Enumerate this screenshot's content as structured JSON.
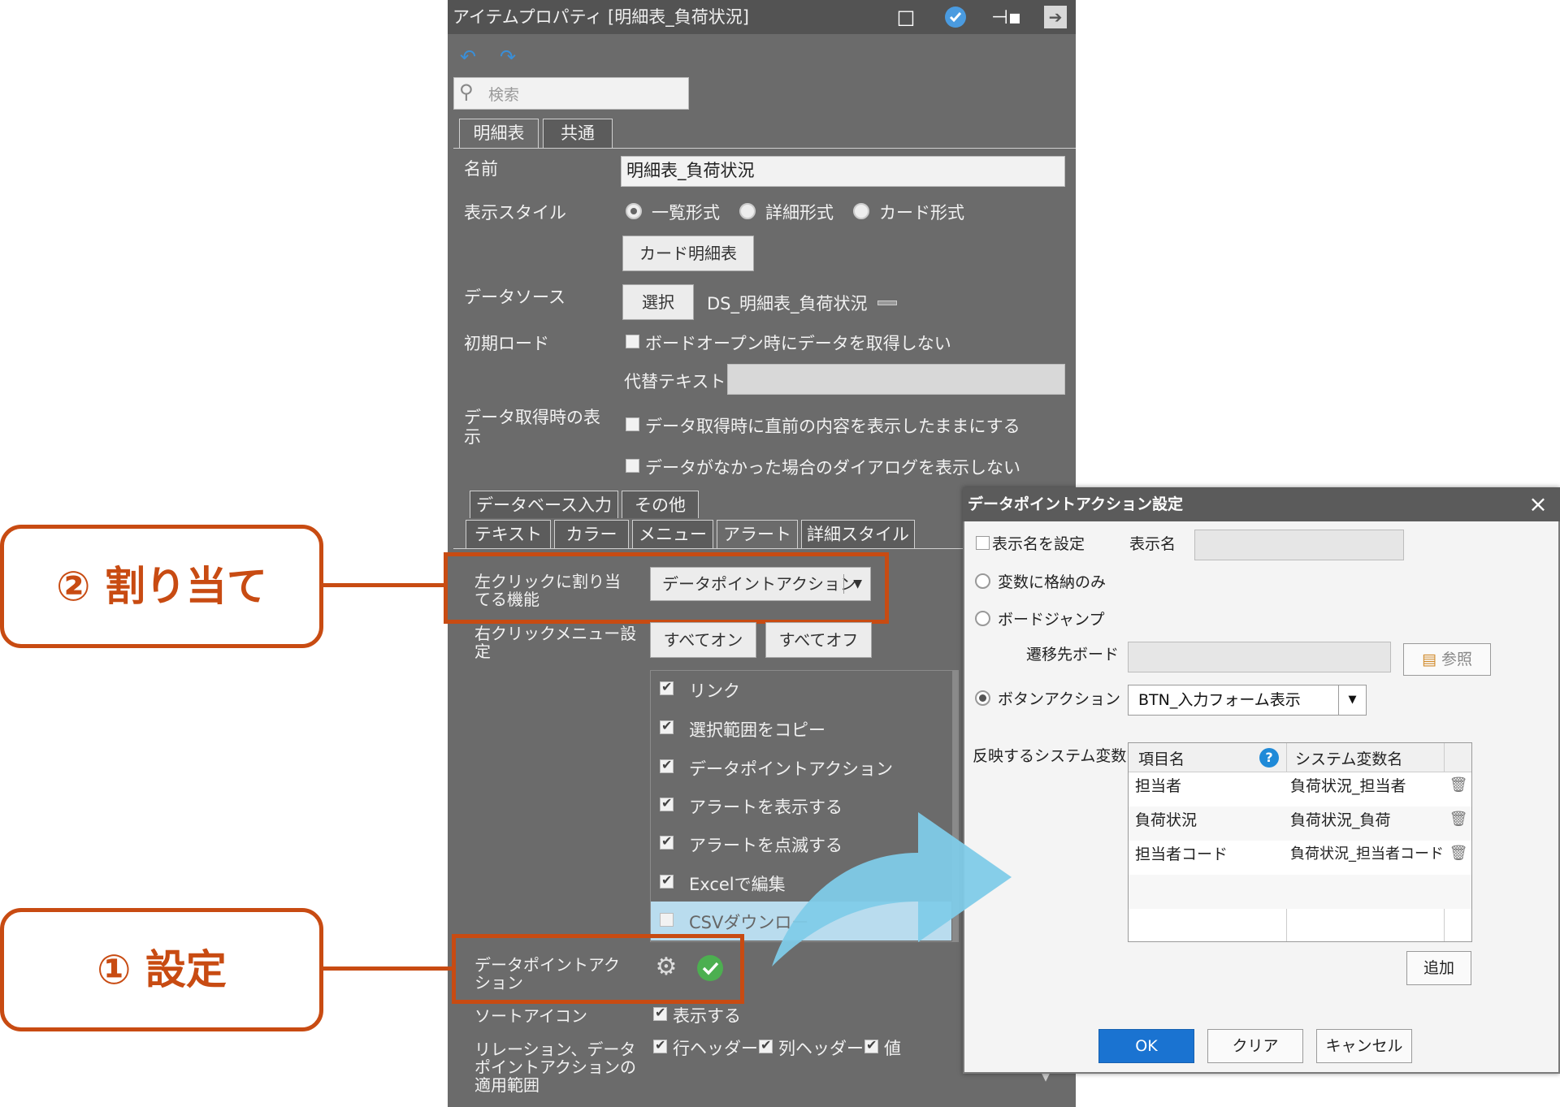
{
  "panel": {
    "title": "アイテムプロパティ [明細表_負荷状況]",
    "search_placeholder": "検索",
    "tabs": [
      "明細表",
      "共通"
    ],
    "name_label": "名前",
    "name_value": "明細表_負荷状況",
    "style_label": "表示スタイル",
    "style_options": [
      "一覧形式",
      "詳細形式",
      "カード形式"
    ],
    "card_button": "カード明細表",
    "datasource_label": "データソース",
    "select_button": "選択",
    "datasource_value": "DS_明細表_負荷状況",
    "initial_load_label": "初期ロード",
    "initial_load_checkbox": "ボードオープン時にデータを取得しない",
    "alt_text_label": "代替テキスト",
    "fetch_display_label_1": "データ取得時の表",
    "fetch_display_label_2": "示",
    "fetch_cb1": "データ取得時に直前の内容を表示したままにする",
    "fetch_cb2": "データがなかった場合のダイアログを表示しない",
    "subtabs_row1": [
      "データベース入力",
      "その他"
    ],
    "subtabs_row2": [
      "テキスト",
      "カラー",
      "メニュー",
      "アラート",
      "詳細スタイル"
    ],
    "left_click_label_1": "左クリックに割り当",
    "left_click_label_2": "てる機能",
    "left_click_value": "データポイントアクション",
    "right_menu_label_1": "右クリックメニュー設",
    "right_menu_label_2": "定",
    "all_on": "すべてオン",
    "all_off": "すべてオフ",
    "menu_items": [
      {
        "label": "リンク",
        "checked": true
      },
      {
        "label": "選択範囲をコピー",
        "checked": true
      },
      {
        "label": "データポイントアクション",
        "checked": true
      },
      {
        "label": "アラートを表示する",
        "checked": true
      },
      {
        "label": "アラートを点滅する",
        "checked": true
      },
      {
        "label": "Excelで編集",
        "checked": true
      },
      {
        "label": "CSVダウンロー",
        "checked": false
      }
    ],
    "dpa_label_1": "データポイントアク",
    "dpa_label_2": "ション",
    "sort_icon_label": "ソートアイコン",
    "sort_icon_cb": "表示する",
    "relation_label_1": "リレーション、データ",
    "relation_label_2": "ポイントアクションの",
    "relation_label_3": "適用範囲",
    "relation_cbs": [
      "行ヘッダー",
      "列ヘッダー",
      "値"
    ]
  },
  "callouts": {
    "assign": "② 割り当て",
    "setting": "① 設定"
  },
  "dialog": {
    "title": "データポイントアクション設定",
    "close": "×",
    "display_name_cb": "表示名を設定",
    "display_name_label": "表示名",
    "radio_store": "変数に格納のみ",
    "radio_board_jump": "ボードジャンプ",
    "target_board_label": "遷移先ボード",
    "browse_button": "参照",
    "radio_button_action": "ボタンアクション",
    "button_action_value": "BTN_入力フォーム表示",
    "sysvar_label": "反映するシステム変数",
    "col_item": "項目名",
    "col_sysvar": "システム変数名",
    "rows": [
      {
        "item": "担当者",
        "var": "負荷状況_担当者"
      },
      {
        "item": "負荷状況",
        "var": "負荷状況_負荷"
      },
      {
        "item": "担当者コード",
        "var": "負荷状況_担当者コード"
      }
    ],
    "add_button": "追加",
    "ok_button": "OK",
    "clear_button": "クリア",
    "cancel_button": "キャンセル"
  },
  "colors": {
    "accent_orange": "#c84b12",
    "ok_blue": "#1a73d1",
    "arrow_blue": "#7fcbe8"
  }
}
